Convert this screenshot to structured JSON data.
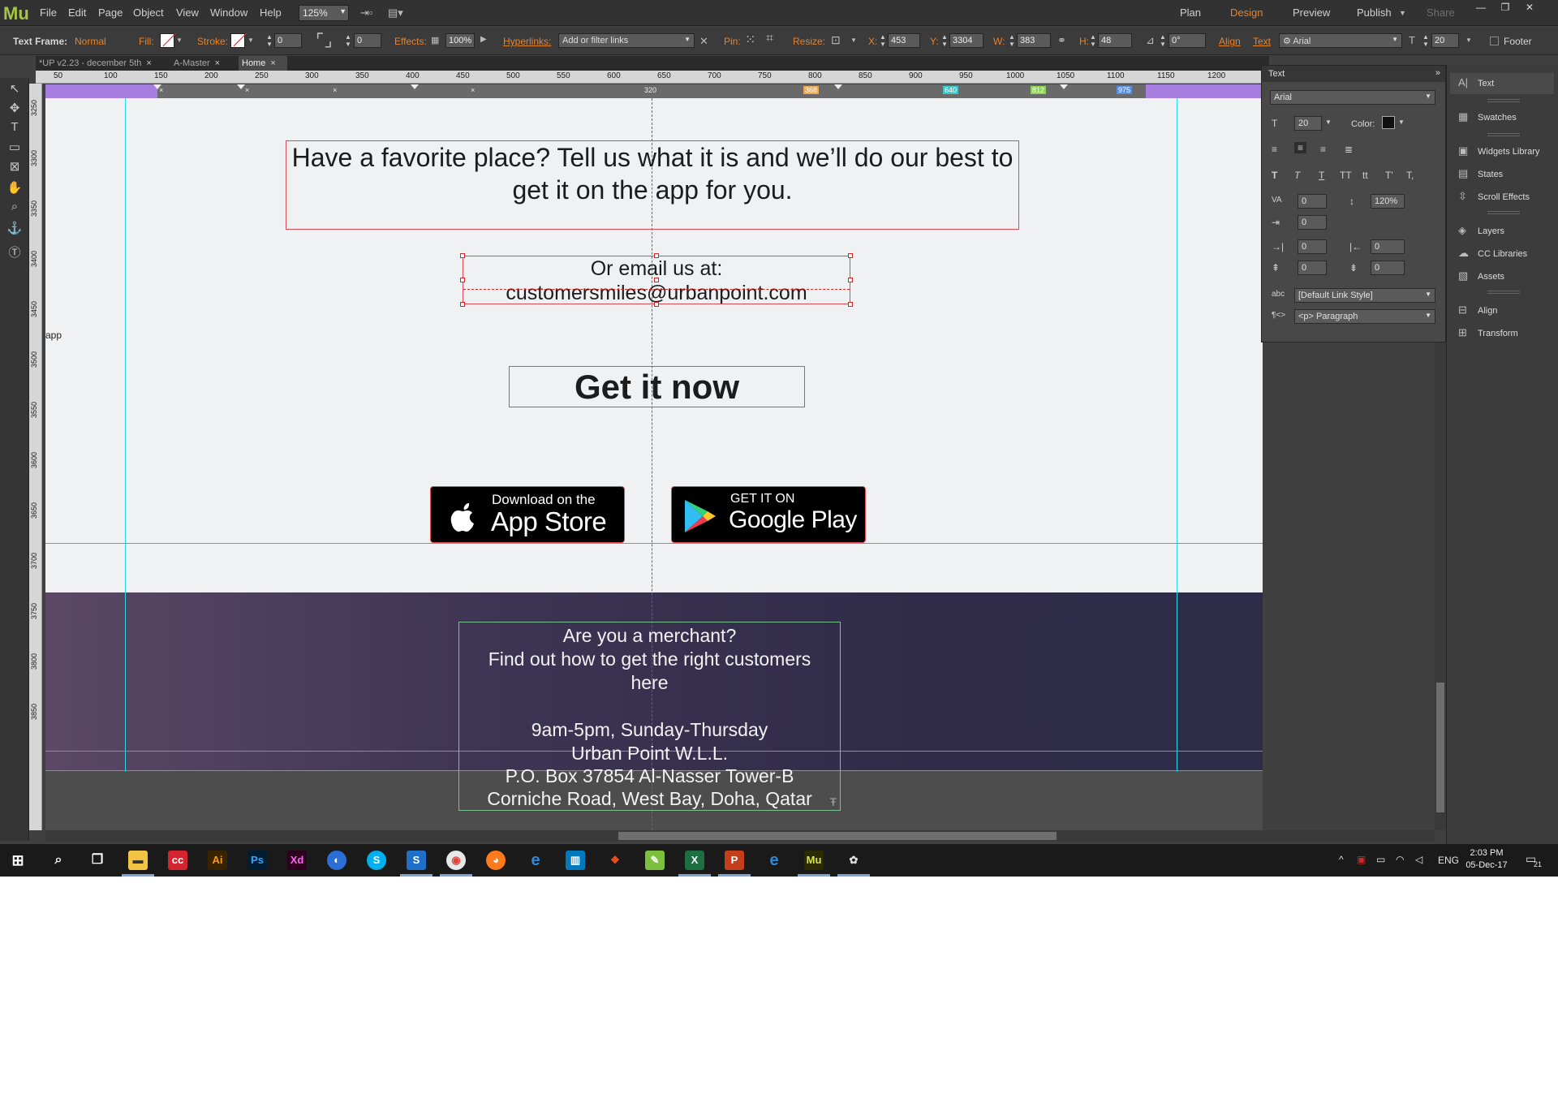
{
  "app": {
    "logo": "Mu"
  },
  "menu": [
    "File",
    "Edit",
    "Page",
    "Object",
    "View",
    "Window",
    "Help"
  ],
  "zoom": "125%",
  "modes": {
    "plan": "Plan",
    "design": "Design",
    "preview": "Preview",
    "publish": "Publish",
    "share": "Share"
  },
  "control": {
    "text_frame_label": "Text Frame:",
    "text_frame_value": "Normal",
    "fill_label": "Fill:",
    "stroke_label": "Stroke:",
    "stroke_value": "0",
    "corner_value": "0",
    "effects_label": "Effects:",
    "opacity": "100%",
    "hyperlinks_label": "Hyperlinks:",
    "hyperlinks_value": "Add or filter links",
    "pin_label": "Pin:",
    "resize_label": "Resize:",
    "x_label": "X:",
    "x_value": "453",
    "y_label": "Y:",
    "y_value": "3304",
    "w_label": "W:",
    "w_value": "383",
    "h_label": "H:",
    "h_value": "48",
    "angle_value": "0°",
    "align_label": "Align",
    "text_label": "Text",
    "font": "Arial",
    "size": "20",
    "footer_label": "Footer"
  },
  "tabs": [
    {
      "label": "*UP v2.23 - december 5th"
    },
    {
      "label": "A-Master"
    },
    {
      "label": "Home"
    }
  ],
  "ruler_h": [
    "50",
    "100",
    "150",
    "200",
    "250",
    "300",
    "350",
    "400",
    "450",
    "500",
    "550",
    "600",
    "650",
    "700",
    "750",
    "800",
    "850",
    "900",
    "950",
    "1000",
    "1050",
    "1100",
    "1150",
    "1200"
  ],
  "ruler_v": [
    "3250",
    "3300",
    "3350",
    "3400",
    "3450",
    "3500",
    "3550",
    "3600",
    "3650",
    "3700",
    "3750",
    "3800",
    "3850"
  ],
  "breakpoints": {
    "center": "320",
    "b1": "368",
    "b2": "640",
    "b3": "812",
    "b4": "975"
  },
  "breakpoint_colors": {
    "b1": "#e8a857",
    "b2": "#3ec6c6",
    "b3": "#8fd15a",
    "b4": "#5a8fe0"
  },
  "canvas": {
    "headline": "Have a favorite place? Tell us what it is and we’ll do our best to get it on the app for you.",
    "email_line1": "Or email us at:",
    "email_line2": "customersmiles@urbanpoint.com",
    "cta": "Get it now",
    "appstore_small": "Download on the",
    "appstore_big": "App Store",
    "googleplay_small": "GET IT ON",
    "googleplay_big": "Google Play",
    "merchant_line1": "Are you a merchant?",
    "merchant_line2": "Find out how to get the right customers",
    "merchant_line3": "here",
    "hours": "9am-5pm, Sunday-Thursday",
    "company": "Urban Point W.L.L.",
    "address1": "P.O. Box 37854 Al-Nasser Tower-B",
    "address2": "Corniche Road, West Bay, Doha, Qatar",
    "app_tag": "app"
  },
  "text_panel": {
    "title": "Text",
    "font": "Arial",
    "size": "20",
    "color_label": "Color:",
    "tracking": "0",
    "leading": "120%",
    "indent": "0",
    "left_indent": "0",
    "right_indent": "0",
    "space_before": "0",
    "space_after": "0",
    "link_style": "[Default Link Style]",
    "paragraph": "<p> Paragraph"
  },
  "right_dock": [
    "Text",
    "Swatches",
    "Widgets Library",
    "States",
    "Scroll Effects",
    "Layers",
    "CC Libraries",
    "Assets",
    "Align",
    "Transform"
  ],
  "taskbar": {
    "lang": "ENG",
    "time": "2:03 PM",
    "date": "05-Dec-17",
    "notif": "21"
  }
}
